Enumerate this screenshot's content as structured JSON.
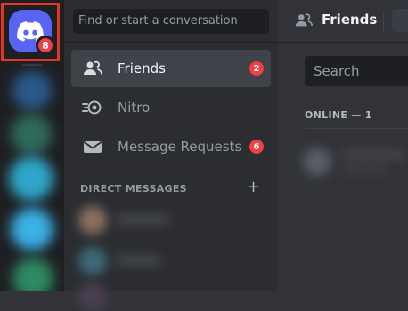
{
  "rail": {
    "home_badge_count": "8"
  },
  "sidebar": {
    "search_placeholder": "Find or start a conversation",
    "items": [
      {
        "label": "Friends",
        "icon": "friends-icon",
        "badge": "2",
        "active": true
      },
      {
        "label": "Nitro",
        "icon": "nitro-icon",
        "badge": null,
        "active": false
      },
      {
        "label": "Message Requests",
        "icon": "envelope-icon",
        "badge": "6",
        "active": false
      }
    ],
    "dm_header": "DIRECT MESSAGES",
    "dm_add_symbol": "+"
  },
  "main": {
    "title": "Friends",
    "search_placeholder": "Search",
    "online_label": "ONLINE — 1"
  },
  "colors": {
    "highlight_border": "#e4361f",
    "brand": "#5865f2",
    "badge": "#f23f43"
  }
}
